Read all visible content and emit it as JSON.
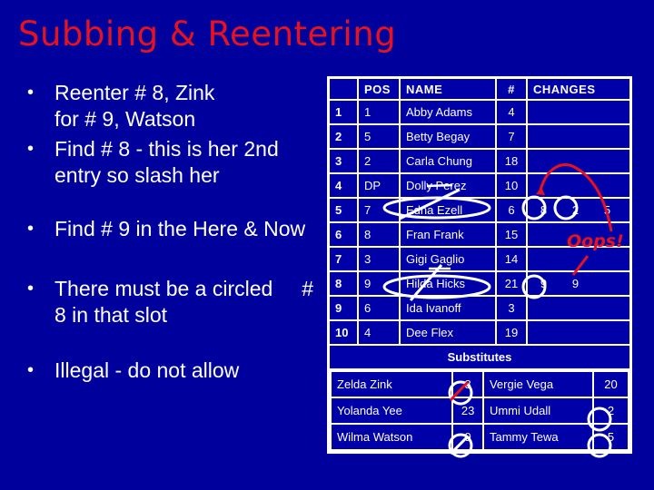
{
  "slide": {
    "title": "Subbing & Reentering",
    "title_color": "#e8121e",
    "background_color": "#00009c",
    "bullets": [
      {
        "text": "Reenter # 8, Zink\nfor # 9, Watson"
      },
      {
        "text": "Find # 8 - this is her 2nd\nentry so slash her"
      },
      {
        "text": "Find # 9 in the Here & Now"
      },
      {
        "text": "There must be a circled     #\n8 in that slot"
      },
      {
        "text": "Illegal - do not allow"
      }
    ],
    "bullet_glyph": "•"
  },
  "lineup": {
    "headers": [
      "",
      "POS",
      "NAME",
      "#",
      "CHANGES"
    ],
    "rows": [
      {
        "slot": "1",
        "pos": "1",
        "name": "Abby Adams",
        "num": "4",
        "changes": []
      },
      {
        "slot": "2",
        "pos": "5",
        "name": "Betty Begay",
        "num": "7",
        "changes": []
      },
      {
        "slot": "3",
        "pos": "2",
        "name": "Carla Chung",
        "num": "18",
        "changes": []
      },
      {
        "slot": "4",
        "pos": "DP",
        "name": "Dolly Perez",
        "num": "10",
        "changes": []
      },
      {
        "slot": "5",
        "pos": "7",
        "name": "Edna Ezell",
        "num": "6",
        "changes": [
          "8",
          "2",
          "5"
        ]
      },
      {
        "slot": "6",
        "pos": "8",
        "name": "Fran Frank",
        "num": "15",
        "changes": []
      },
      {
        "slot": "7",
        "pos": "3",
        "name": "Gigi Gaglio",
        "num": "14",
        "changes": []
      },
      {
        "slot": "8",
        "pos": "9",
        "name": "Hilda Hicks",
        "num": "21",
        "changes": [
          "9",
          "9"
        ]
      },
      {
        "slot": "9",
        "pos": "6",
        "name": "Ida Ivanoff",
        "num": "3",
        "changes": []
      },
      {
        "slot": "10",
        "pos": "4",
        "name": "Dee Flex",
        "num": "19",
        "changes": []
      }
    ],
    "substitutes_title": "Substitutes",
    "substitutes": [
      {
        "left_name": "Zelda Zink",
        "left_num": "8",
        "right_name": "Vergie Vega",
        "right_num": "20"
      },
      {
        "left_name": "Yolanda Yee",
        "left_num": "23",
        "right_name": "Ummi Udall",
        "right_num": "2"
      },
      {
        "left_name": "Wilma Watson",
        "left_num": "9",
        "right_name": "Tammy Tewa",
        "right_num": "5"
      }
    ]
  },
  "annotations": {
    "oops_label": "Oops!",
    "oops_color": "#e8121e",
    "circled_changes": [
      "row5: 8",
      "row5: 2",
      "row8: 9"
    ],
    "circled_subs": [
      "Zelda Zink 8",
      "Wilma Watson 9",
      "Ummi Udall 2",
      "Tammy Tewa 5"
    ],
    "slashed_subs": [
      "Zelda Zink 8 (red slash)",
      "Wilma Watson 9 (white slash)"
    ],
    "ellipsed_names": [
      "Edna Ezell",
      "Hilda Hicks"
    ]
  }
}
